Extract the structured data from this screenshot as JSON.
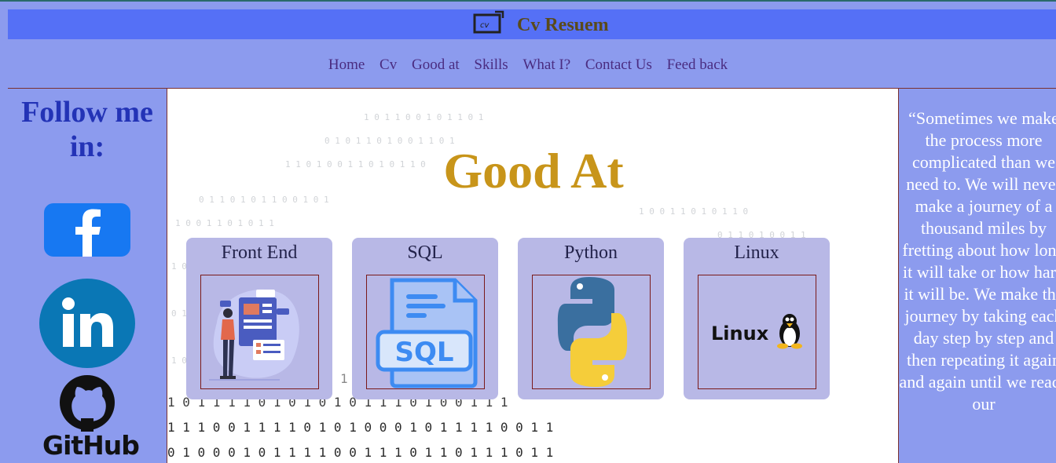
{
  "header": {
    "title": "Cv Resuem"
  },
  "nav": {
    "items": [
      "Home",
      "Cv",
      "Good at",
      "Skills",
      "What I?",
      "Contact Us",
      "Feed back"
    ]
  },
  "sidebar": {
    "follow_label": "Follow me in:",
    "github_label": "GitHub"
  },
  "main": {
    "heading": "Good At",
    "cards": [
      {
        "title": "Front End"
      },
      {
        "title": "SQL",
        "image_text": "SQL"
      },
      {
        "title": "Python"
      },
      {
        "title": "Linux",
        "image_text": "Linux"
      }
    ]
  },
  "quote": {
    "text": "“Sometimes we make the process more complicated than we need to. We will never make a journey of a thousand miles by fretting about how long it will take or how hard it will be. We make the journey by taking each day step by step and then repeating it again and again until we reach our"
  },
  "colors": {
    "header": "#5570f6",
    "page": "#8c9bee",
    "heading": "#c8951a",
    "card": "#b8b8e6"
  }
}
